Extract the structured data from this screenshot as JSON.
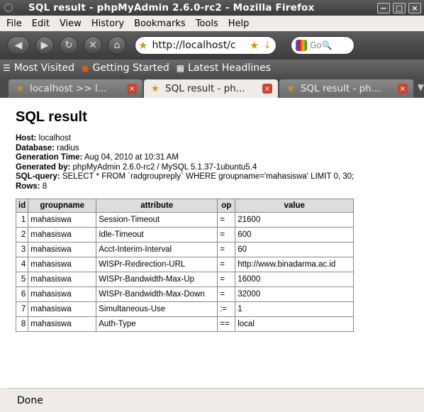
{
  "window": {
    "title": "SQL result - phpMyAdmin 2.6.0-rc2 - Mozilla Firefox"
  },
  "menu": {
    "items": [
      "File",
      "Edit",
      "View",
      "History",
      "Bookmarks",
      "Tools",
      "Help"
    ]
  },
  "navigation": {
    "url": "http://localhost/c",
    "search_placeholder": "Go"
  },
  "bookmarks": {
    "items": [
      "Most Visited",
      "Getting Started",
      "Latest Headlines"
    ]
  },
  "tabs": [
    {
      "label": "localhost >> l..."
    },
    {
      "label": "SQL result - ph...",
      "active": true
    },
    {
      "label": "SQL result - ph..."
    }
  ],
  "page": {
    "heading": "SQL result",
    "meta": {
      "host_label": "Host:",
      "host": "localhost",
      "database_label": "Database:",
      "database": "radius",
      "gen_time_label": "Generation Time:",
      "gen_time": "Aug 04, 2010 at 10:31 AM",
      "gen_by_label": "Generated by:",
      "gen_by": "phpMyAdmin 2.6.0-rc2 / MySQL 5.1.37-1ubuntu5.4",
      "query_label": "SQL-query:",
      "query": "SELECT * FROM `radgroupreply` WHERE groupname='mahasiswa' LIMIT 0, 30;",
      "rows_label": "Rows:",
      "rows": "8"
    },
    "table": {
      "columns": [
        "id",
        "groupname",
        "attribute",
        "op",
        "value"
      ],
      "rows": [
        [
          "1",
          "mahasiswa",
          "Session-Timeout",
          "=",
          "21600"
        ],
        [
          "2",
          "mahasiswa",
          "Idle-Timeout",
          "=",
          "600"
        ],
        [
          "3",
          "mahasiswa",
          "Acct-Interim-Interval",
          "=",
          "60"
        ],
        [
          "4",
          "mahasiswa",
          "WISPr-Redirection-URL",
          "=",
          "http://www.binadarma.ac.id"
        ],
        [
          "5",
          "mahasiswa",
          "WISPr-Bandwidth-Max-Up",
          "=",
          "16000"
        ],
        [
          "6",
          "mahasiswa",
          "WISPr-Bandwidth-Max-Down",
          "=",
          "32000"
        ],
        [
          "7",
          "mahasiswa",
          "Simultaneous-Use",
          ":=",
          "1"
        ],
        [
          "8",
          "mahasiswa",
          "Auth-Type",
          "==",
          "local"
        ]
      ]
    }
  },
  "status": {
    "text": "Done"
  }
}
